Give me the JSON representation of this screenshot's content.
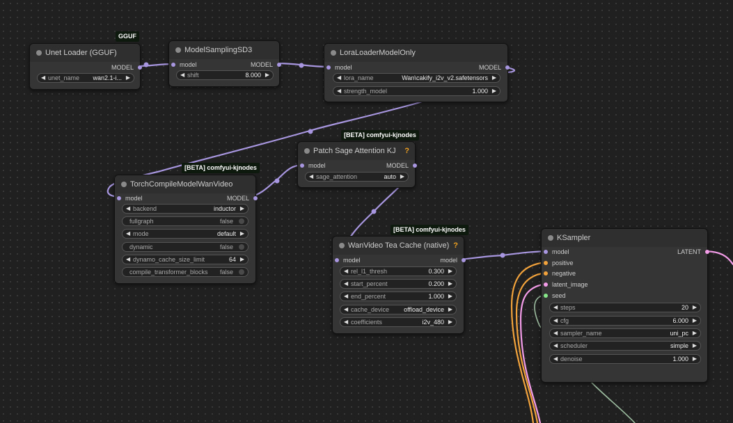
{
  "colors": {
    "canvas": "#202020",
    "node_body": "#353535",
    "node_title": "#2f2f2f",
    "model_wire": "#a897e0",
    "positive_wire": "#f3a33c",
    "latent_wire": "#f39ce8",
    "seed_wire": "#86e68a",
    "help_mark": "#f0a020"
  },
  "nodes": {
    "unet_loader": {
      "badge": "GGUF",
      "title": "Unet Loader (GGUF)",
      "output": "MODEL",
      "widgets": {
        "unet_name": {
          "label": "unet_name",
          "value": "wan2.1-i..."
        }
      }
    },
    "model_sampling": {
      "title": "ModelSamplingSD3",
      "input": "model",
      "output": "MODEL",
      "widgets": {
        "shift": {
          "label": "shift",
          "value": "8.000"
        }
      }
    },
    "lora_loader": {
      "title": "LoraLoaderModelOnly",
      "input": "model",
      "output": "MODEL",
      "widgets": {
        "lora_name": {
          "label": "lora_name",
          "value": "Wan\\cakify_i2v_v2.safetensors"
        },
        "strength_model": {
          "label": "strength_model",
          "value": "1.000"
        }
      }
    },
    "patch_sage": {
      "badge": "[BETA] comfyui-kjnodes",
      "title": "Patch Sage Attention KJ",
      "help": "?",
      "input": "model",
      "output": "MODEL",
      "widgets": {
        "sage_attention": {
          "label": "sage_attention",
          "value": "auto"
        }
      }
    },
    "torch_compile": {
      "badge": "[BETA] comfyui-kjnodes",
      "title": "TorchCompileModelWanVideo",
      "input": "model",
      "output": "MODEL",
      "widgets": {
        "backend": {
          "label": "backend",
          "value": "inductor"
        },
        "fullgraph": {
          "label": "fullgraph",
          "value": "false"
        },
        "mode": {
          "label": "mode",
          "value": "default"
        },
        "dynamic": {
          "label": "dynamic",
          "value": "false"
        },
        "dynamo_cache_size_limit": {
          "label": "dynamo_cache_size_limit",
          "value": "64"
        },
        "compile_transformer_blocks": {
          "label": "compile_transformer_blocks",
          "value": "false"
        }
      }
    },
    "tea_cache": {
      "badge": "[BETA] comfyui-kjnodes",
      "title": "WanVideo Tea Cache (native)",
      "help": "?",
      "input": "model",
      "output": "model",
      "widgets": {
        "rel_l1_thresh": {
          "label": "rel_l1_thresh",
          "value": "0.300"
        },
        "start_percent": {
          "label": "start_percent",
          "value": "0.200"
        },
        "end_percent": {
          "label": "end_percent",
          "value": "1.000"
        },
        "cache_device": {
          "label": "cache_device",
          "value": "offload_device"
        },
        "coefficients": {
          "label": "coefficients",
          "value": "i2v_480"
        }
      }
    },
    "ksampler": {
      "title": "KSampler",
      "output": "LATENT",
      "inputs": {
        "model": "model",
        "positive": "positive",
        "negative": "negative",
        "latent_image": "latent_image",
        "seed": "seed"
      },
      "widgets": {
        "steps": {
          "label": "steps",
          "value": "20"
        },
        "cfg": {
          "label": "cfg",
          "value": "6.000"
        },
        "sampler_name": {
          "label": "sampler_name",
          "value": "uni_pc"
        },
        "scheduler": {
          "label": "scheduler",
          "value": "simple"
        },
        "denoise": {
          "label": "denoise",
          "value": "1.000"
        }
      }
    }
  }
}
